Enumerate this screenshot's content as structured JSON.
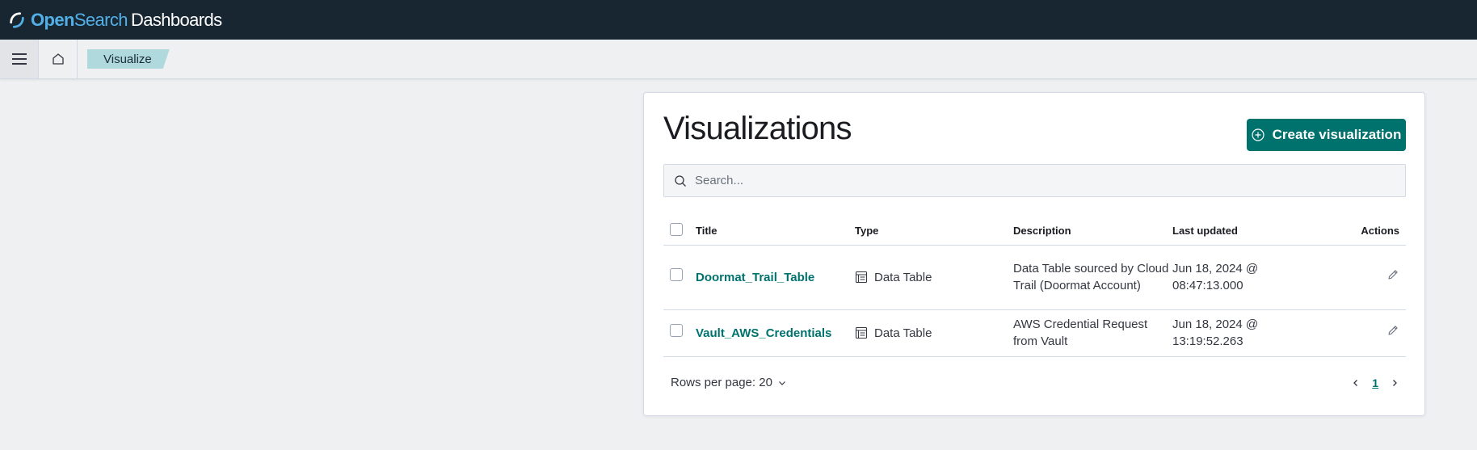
{
  "brand": {
    "part1": "Open",
    "part2": "Search",
    "part3": "Dashboards"
  },
  "breadcrumb": {
    "current": "Visualize"
  },
  "page": {
    "title": "Visualizations",
    "create_button": "Create visualization"
  },
  "search": {
    "placeholder": "Search..."
  },
  "table": {
    "headers": {
      "title": "Title",
      "type": "Type",
      "description": "Description",
      "last_updated": "Last updated",
      "actions": "Actions"
    },
    "rows": [
      {
        "title": "Doormat_Trail_Table",
        "type": "Data Table",
        "description": "Data Table sourced by Cloud Trail (Doormat Account)",
        "updated_line1": "Jun 18, 2024 @",
        "updated_line2": "08:47:13.000"
      },
      {
        "title": "Vault_AWS_Credentials",
        "type": "Data Table",
        "description": "AWS Credential Request from Vault",
        "updated_line1": "Jun 18, 2024 @",
        "updated_line2": "13:19:52.263"
      }
    ]
  },
  "pagination": {
    "rows_per_page": "Rows per page: 20",
    "current_page": "1"
  },
  "colors": {
    "accent": "#00726e",
    "topbar": "#182632",
    "breadcrumb": "#b0d9de"
  },
  "icons": [
    "opensearch-logo-icon",
    "hamburger-menu-icon",
    "home-icon",
    "plus-circle-icon",
    "search-icon",
    "table-icon",
    "pencil-icon",
    "chevron-down-icon",
    "chevron-left-icon",
    "chevron-right-icon"
  ]
}
